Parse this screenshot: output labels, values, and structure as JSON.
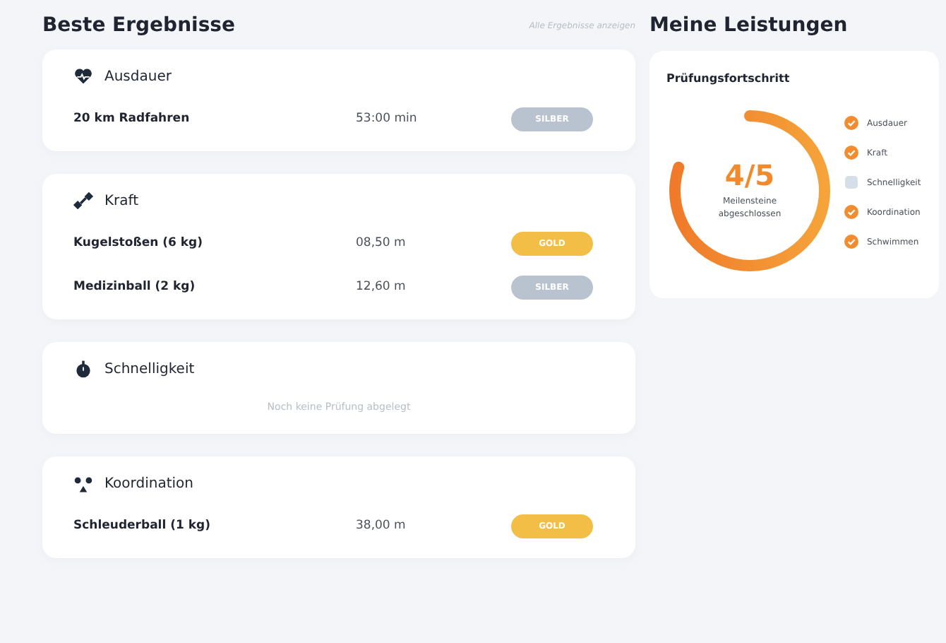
{
  "results": {
    "title": "Beste Ergebnisse",
    "link": "Alle Ergebnisse anzeigen",
    "categories": [
      {
        "name": "Ausdauer",
        "kind": "heart",
        "entries": [
          {
            "exercise": "20 km Radfahren",
            "value": "53:00 min",
            "medal": "SILBER",
            "kind": "silver"
          }
        ]
      },
      {
        "name": "Kraft",
        "kind": "dumbbell",
        "entries": [
          {
            "exercise": "Kugelstoßen (6 kg)",
            "value": "08,50 m",
            "medal": "GOLD",
            "kind": "gold"
          },
          {
            "exercise": "Medizinball (2 kg)",
            "value": "12,60 m",
            "medal": "SILBER",
            "kind": "silver"
          }
        ]
      },
      {
        "name": "Schnelligkeit",
        "kind": "stopwatch",
        "empty_text": "Noch keine Prüfung abgelegt"
      },
      {
        "name": "Koordination",
        "kind": "people",
        "entries": [
          {
            "exercise": "Schleuderball (1 kg)",
            "value": "38,00 m",
            "medal": "GOLD",
            "kind": "gold"
          }
        ]
      }
    ]
  },
  "achievements": {
    "title": "Meine Leistungen",
    "card_title": "Prüfungsfortschritt",
    "progress": {
      "value": "4/5",
      "caption": "Meilensteine abgeschlossen",
      "level": 0.8
    },
    "milestones": [
      {
        "label": "Ausdauer",
        "checked": true
      },
      {
        "label": "Kraft",
        "checked": true
      },
      {
        "label": "Schnelligkeit",
        "checked": false
      },
      {
        "label": "Koordination",
        "checked": true
      },
      {
        "label": "Schwimmen",
        "checked": true
      }
    ]
  }
}
